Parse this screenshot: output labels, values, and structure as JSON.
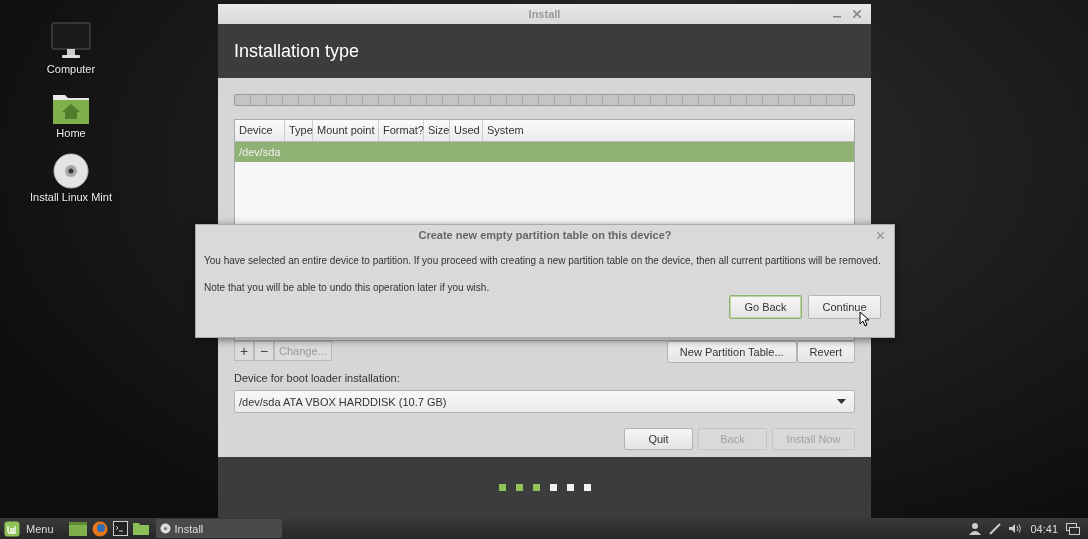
{
  "desktop_icons": [
    {
      "label": "Computer",
      "kind": "monitor"
    },
    {
      "label": "Home",
      "kind": "folder"
    },
    {
      "label": "Install Linux Mint",
      "kind": "disc"
    }
  ],
  "window": {
    "title": "Install",
    "heading": "Installation type",
    "partition_table": {
      "columns": [
        "Device",
        "Type",
        "Mount point",
        "Format?",
        "Size",
        "Used",
        "System"
      ],
      "rows": [
        {
          "device": "/dev/sda",
          "selected": true
        }
      ]
    },
    "toolbar": {
      "add": "+",
      "remove": "−",
      "change": {
        "label": "Change...",
        "disabled": true
      },
      "new_table": "New Partition Table...",
      "revert": "Revert"
    },
    "bootloader": {
      "label": "Device for boot loader installation:",
      "value": "/dev/sda  ATA VBOX HARDDISK (10.7 GB)"
    },
    "buttons": [
      {
        "label": "Quit",
        "disabled": false
      },
      {
        "label": "Back",
        "disabled": true
      },
      {
        "label": "Install Now",
        "disabled": true
      }
    ],
    "steps": [
      {
        "done": true
      },
      {
        "done": true
      },
      {
        "done": true
      },
      {
        "done": false
      },
      {
        "done": false
      },
      {
        "done": false
      }
    ]
  },
  "dialog": {
    "title": "Create new empty partition table on this device?",
    "message": "You have selected an entire device to partition. If you proceed with creating a new partition table on the device, then all current partitions will be removed.",
    "note": "Note that you will be able to undo this operation later if you wish.",
    "buttons": [
      {
        "label": "Go Back",
        "selected": true
      },
      {
        "label": "Continue",
        "selected": false
      }
    ]
  },
  "taskbar": {
    "menu": "Menu",
    "tasks": [
      {
        "label": "Install",
        "selected": true
      }
    ],
    "clock": "04:41"
  }
}
